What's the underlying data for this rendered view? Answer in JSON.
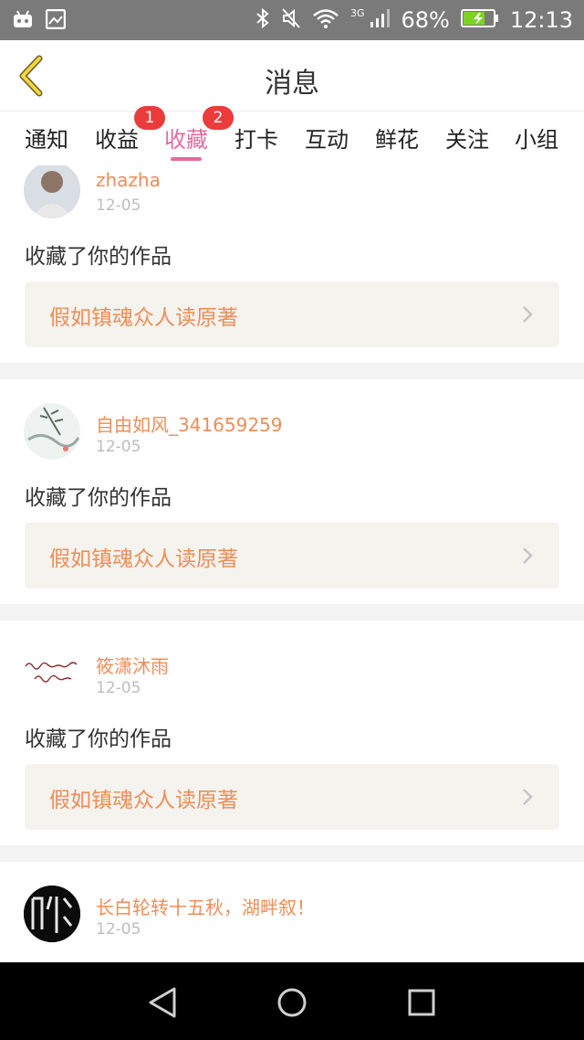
{
  "status_bar": {
    "network": "3G",
    "battery": "68%",
    "time": "12:13"
  },
  "header": {
    "title": "消息",
    "back_icon": "chevron-left-icon"
  },
  "tabs": [
    {
      "label": "通知"
    },
    {
      "label": "收益",
      "badge": "1"
    },
    {
      "label": "收藏",
      "badge": "2",
      "active": true
    },
    {
      "label": "打卡"
    },
    {
      "label": "互动"
    },
    {
      "label": "鲜花"
    },
    {
      "label": "关注"
    },
    {
      "label": "小组"
    }
  ],
  "colors": {
    "accent": "#e06c9f",
    "username": "#ef8d57",
    "badge": "#ec3b3b",
    "work_bg": "#f4f3ee"
  },
  "messages": [
    {
      "username": "zhazha",
      "date": "12-05",
      "action": "收藏了你的作品",
      "work_title": "假如镇魂众人读原著"
    },
    {
      "username": "自由如风_341659259",
      "date": "12-05",
      "action": "收藏了你的作品",
      "work_title": "假如镇魂众人读原著"
    },
    {
      "username": "筱潇沐雨",
      "date": "12-05",
      "action": "收藏了你的作品",
      "work_title": "假如镇魂众人读原著"
    },
    {
      "username": "长白轮转十五秋，湖畔叙！",
      "date": "12-05"
    }
  ]
}
